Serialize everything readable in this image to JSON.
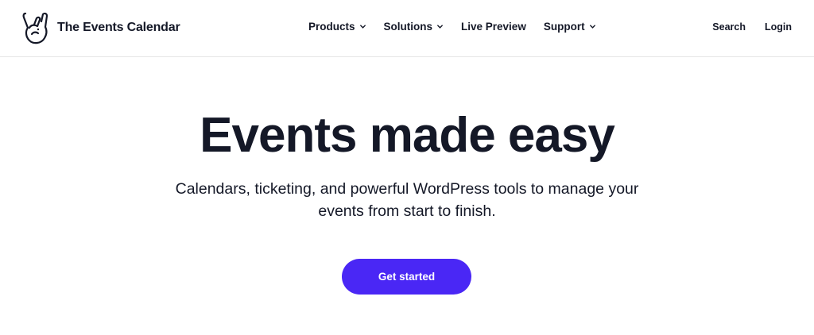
{
  "brand": {
    "name": "The Events Calendar",
    "logo_icon": "rock-hand-icon"
  },
  "nav": {
    "items": [
      {
        "label": "Products",
        "has_dropdown": true
      },
      {
        "label": "Solutions",
        "has_dropdown": true
      },
      {
        "label": "Live Preview",
        "has_dropdown": false
      },
      {
        "label": "Support",
        "has_dropdown": true
      }
    ]
  },
  "utility": {
    "search_label": "Search",
    "login_label": "Login"
  },
  "hero": {
    "title": "Events made easy",
    "subtitle": "Calendars, ticketing, and powerful WordPress tools to manage your events from start to finish.",
    "cta_label": "Get started"
  },
  "colors": {
    "text": "#141827",
    "accent": "#4a27f5",
    "background": "#ffffff"
  }
}
